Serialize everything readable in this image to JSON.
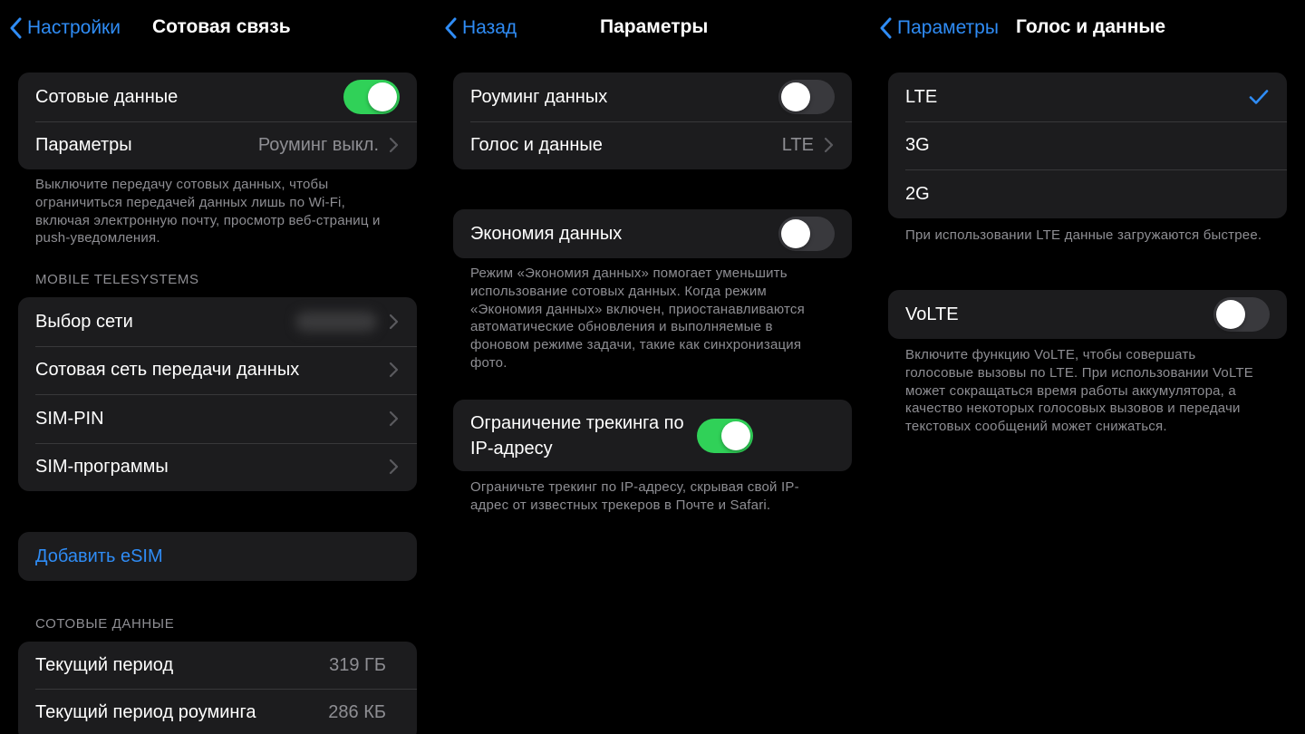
{
  "colors": {
    "accent": "#2f8cf5",
    "toggle_on": "#30d158",
    "toggle_off": "#39393d",
    "cell_bg": "#1c1c1e",
    "secondary_text": "#8e8e93"
  },
  "panel1": {
    "back_label": "Настройки",
    "title": "Сотовая связь",
    "cellular_data_label": "Сотовые данные",
    "cellular_data_on": true,
    "options_label": "Параметры",
    "options_value": "Роуминг выкл.",
    "cellular_footer": "Выключите передачу сотовых данных, чтобы ограничиться передачей данных лишь по Wi-Fi, включая электронную почту, просмотр веб-страниц и push-уведомления.",
    "carrier_header": "MOBILE TELESYSTEMS",
    "carrier_items": [
      "Выбор сети",
      "Сотовая сеть передачи данных",
      "SIM-PIN",
      "SIM-программы"
    ],
    "add_esim": "Добавить eSIM",
    "usage_header": "СОТОВЫЕ ДАННЫЕ",
    "usage_rows": [
      {
        "label": "Текущий период",
        "value": "319 ГБ"
      },
      {
        "label": "Текущий период роуминга",
        "value": "286 КБ"
      }
    ]
  },
  "panel2": {
    "back_label": "Назад",
    "title": "Параметры",
    "roaming_label": "Роуминг данных",
    "roaming_on": false,
    "voice_data_label": "Голос и данные",
    "voice_data_value": "LTE",
    "low_data_label": "Экономия данных",
    "low_data_on": false,
    "low_data_footer": "Режим «Экономия данных» помогает уменьшить использование сотовых данных. Когда режим «Экономия данных» включен, приостанавливаются автоматические обновления и выполняемые в фоновом режиме задачи, такие как синхронизация фото.",
    "ip_tracking_label": "Ограничение трекинга по IP-адресу",
    "ip_tracking_on": true,
    "ip_tracking_footer": "Ограничьте трекинг по IP-адресу, скрывая свой IP-адрес от известных трекеров в Почте и Safari."
  },
  "panel3": {
    "back_label": "Параметры",
    "title": "Голос и данные",
    "options": [
      "LTE",
      "3G",
      "2G"
    ],
    "selected": "LTE",
    "options_footer": "При использовании LTE данные загружаются быстрее.",
    "volte_label": "VoLTE",
    "volte_on": false,
    "volte_footer": "Включите функцию VoLTE, чтобы совершать голосовые вызовы по LTE. При использовании VoLTE может сокращаться время работы аккумулятора, а качество некоторых голосовых вызовов и передачи текстовых сообщений может снижаться.",
    "icons": {
      "back": "chevron-left-icon",
      "disclosure": "chevron-right-icon",
      "selected": "checkmark-icon"
    }
  }
}
